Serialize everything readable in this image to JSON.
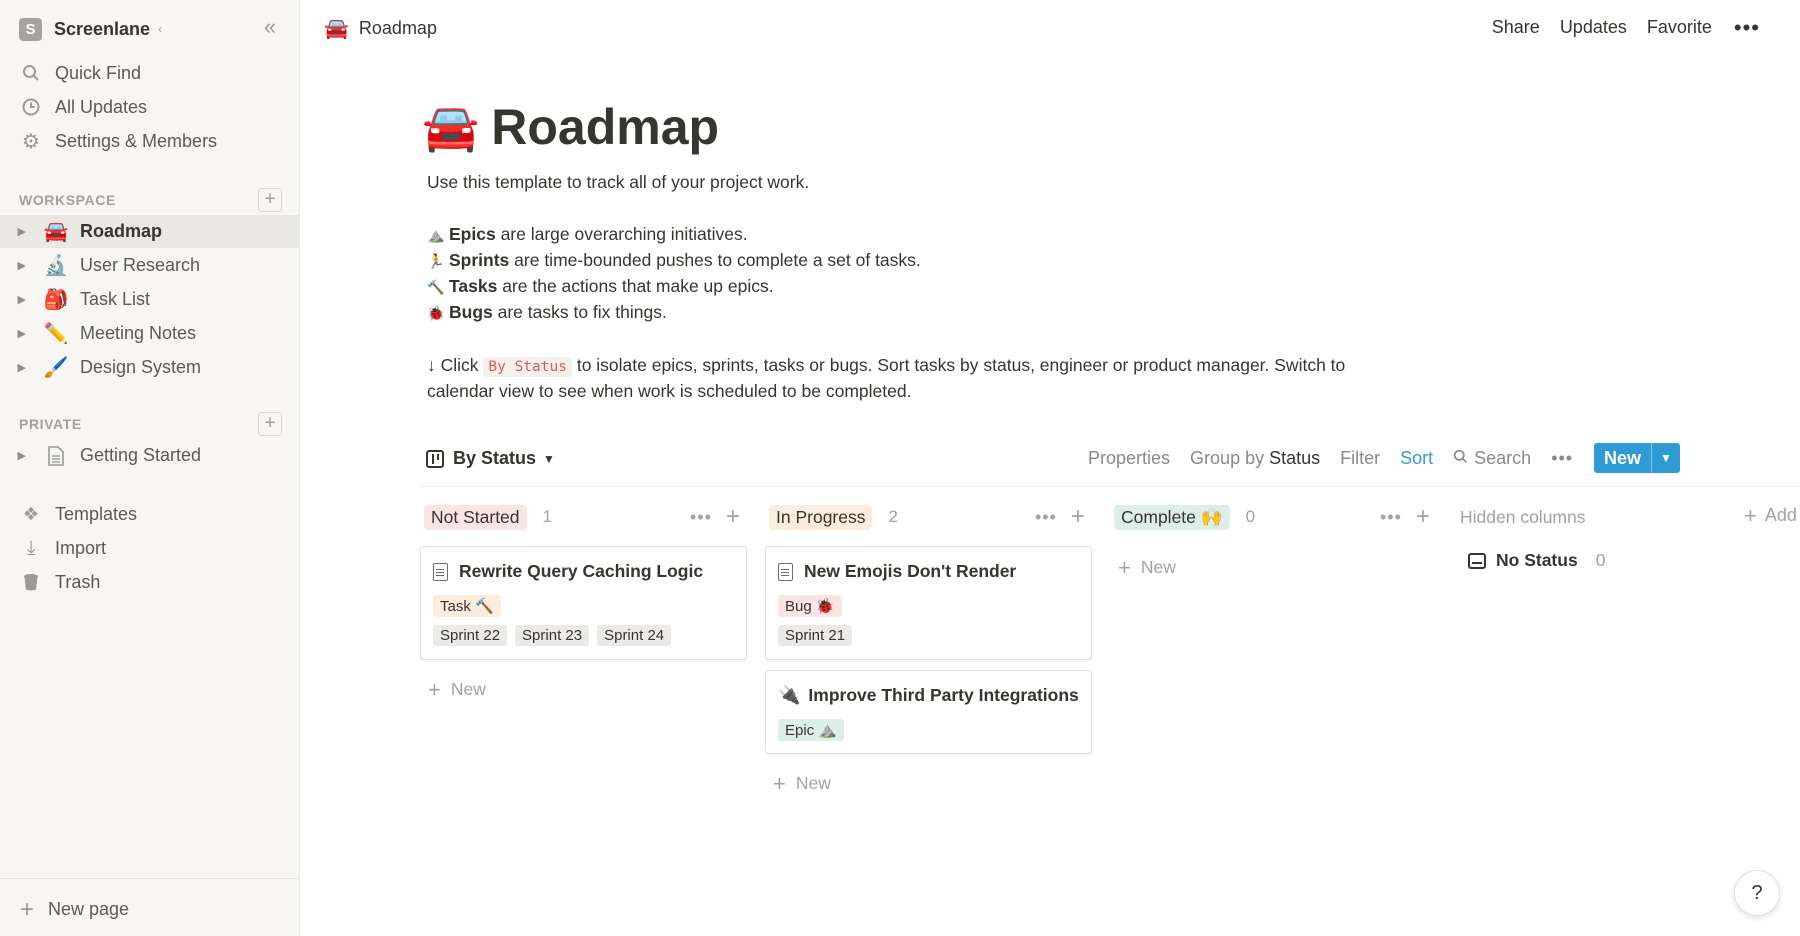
{
  "workspace": {
    "badge": "S",
    "name": "Screenlane"
  },
  "icons": {
    "collapse": "double-chevron-left-icon",
    "search": "search-icon",
    "clock": "clock-icon",
    "gear": "gear-icon"
  },
  "sidebar": {
    "nav": [
      {
        "label": "Quick Find",
        "icon": "⌕"
      },
      {
        "label": "All Updates",
        "icon": "◷"
      },
      {
        "label": "Settings & Members",
        "icon": "⚙"
      }
    ],
    "workspace_label": "WORKSPACE",
    "workspace_pages": [
      {
        "label": "Roadmap",
        "emoji": "🚘",
        "active": true
      },
      {
        "label": "User Research",
        "emoji": "🔬"
      },
      {
        "label": "Task List",
        "emoji": "🎒"
      },
      {
        "label": "Meeting Notes",
        "emoji": "✏️"
      },
      {
        "label": "Design System",
        "emoji": "🖌️"
      }
    ],
    "private_label": "PRIVATE",
    "private_pages": [
      {
        "label": "Getting Started",
        "emoji": "📄"
      }
    ],
    "bottom": [
      {
        "label": "Templates",
        "icon": "❖"
      },
      {
        "label": "Import",
        "icon": "⤓"
      },
      {
        "label": "Trash",
        "icon": "🗑"
      }
    ],
    "new_page": "New page"
  },
  "topbar": {
    "crumb_emoji": "🚘",
    "crumb": "Roadmap",
    "share": "Share",
    "updates": "Updates",
    "favorite": "Favorite",
    "more": "•••"
  },
  "page": {
    "emoji": "🚘",
    "title": "Roadmap",
    "intro": "Use this template to track all of your project work.",
    "bullets": [
      {
        "emoji": "⛰️",
        "bold": "Epics",
        "text": " are large overarching initiatives."
      },
      {
        "emoji": "🏃",
        "bold": "Sprints",
        "text": " are time-bounded pushes to complete a set of tasks."
      },
      {
        "emoji": "🔨",
        "bold": "Tasks",
        "text": " are the actions that make up epics."
      },
      {
        "emoji": "🐞",
        "bold": "Bugs",
        "text": " are tasks to fix things."
      }
    ],
    "click_prefix": "↓ Click ",
    "click_code": "By Status",
    "click_suffix": " to isolate epics, sprints, tasks or bugs. Sort tasks by status, engineer or product manager. Switch to",
    "click_line2": "calendar view to see when work is scheduled to be completed."
  },
  "view": {
    "name": "By Status",
    "properties": "Properties",
    "group_by": "Group by",
    "group_by_value": "Status",
    "filter": "Filter",
    "sort": "Sort",
    "search": "Search",
    "more": "•••",
    "new_label": "New",
    "new_caret": "⌄"
  },
  "columns": [
    {
      "label": "Not Started",
      "count": "1",
      "color": "#fbe4e4",
      "new": "New",
      "cards": [
        {
          "title": "Rewrite Query Caching Logic",
          "tags": [
            {
              "label": "Task 🔨",
              "tone": "orange"
            }
          ],
          "sprints": [
            "Sprint 22",
            "Sprint 23",
            "Sprint 24"
          ]
        }
      ]
    },
    {
      "label": "In Progress",
      "count": "2",
      "color": "#fbecdd",
      "new": "New",
      "cards": [
        {
          "title": "New Emojis Don't Render",
          "tags": [
            {
              "label": "Bug 🐞",
              "tone": "red"
            }
          ],
          "sprints": [
            "Sprint 21"
          ]
        },
        {
          "title": "Improve Third Party Integrations",
          "emoji": "🔌",
          "tags": [
            {
              "label": "Epic ⛰️",
              "tone": "green"
            }
          ],
          "sprints": []
        }
      ]
    },
    {
      "label": "Complete 🙌",
      "count": "0",
      "color": "#ddedea",
      "new": "New",
      "cards": []
    }
  ],
  "hidden_columns": {
    "label": "Hidden columns",
    "add": "Add",
    "no_status": "No Status",
    "no_status_count": "0"
  },
  "help": "?"
}
